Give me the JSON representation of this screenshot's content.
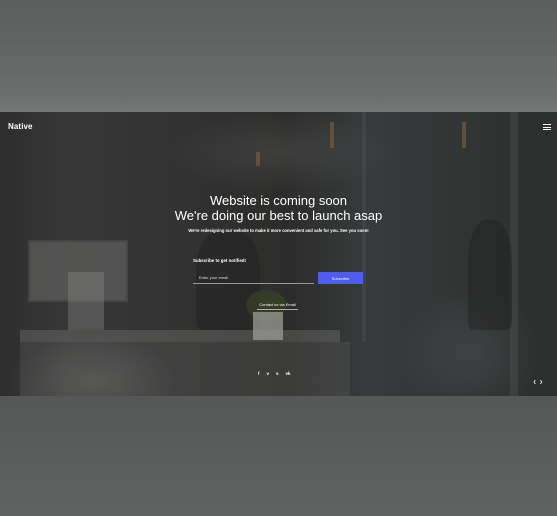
{
  "brand": "Native",
  "hero": {
    "title_line1": "Website is coming soon",
    "title_line2": "We're doing our best to launch asap",
    "lead": "We're redesigning our website to make it more convenient and safe for you. See you soon!"
  },
  "subscribe": {
    "label": "Subscribe to get notified!",
    "email_placeholder": "Enter your email",
    "button_label": "Subscribe"
  },
  "contact_link": "Contact us via Email",
  "social": [
    {
      "icon": "facebook-icon",
      "glyph": "f"
    },
    {
      "icon": "vimeo-icon",
      "glyph": "v"
    },
    {
      "icon": "skype-icon",
      "glyph": "s"
    },
    {
      "icon": "vk-icon",
      "glyph": "vk"
    }
  ],
  "slide_nav": {
    "prev": "❮",
    "next": "❯"
  },
  "colors": {
    "accent": "#4f5cf2",
    "text": "#ffffff",
    "backdrop": "#5b5f5e"
  }
}
